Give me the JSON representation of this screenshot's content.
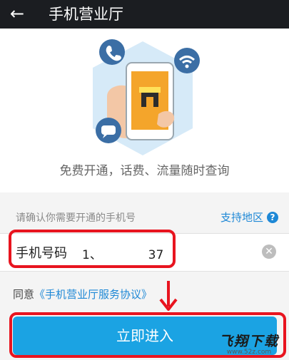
{
  "header": {
    "back_icon": "arrow-left-icon",
    "title": "手机营业厅"
  },
  "hero": {
    "tagline": "免费开通，话费、流量随时查询",
    "icons": [
      "phone-call-icon",
      "wifi-icon",
      "chat-icon",
      "store-icon"
    ]
  },
  "form": {
    "prompt": "请确认你需要开通的手机号",
    "support_link": "支持地区",
    "help_icon": "?",
    "phone_label": "手机号码",
    "phone_value": "1、            37",
    "clear_icon": "✕"
  },
  "agreement": {
    "prefix": "同意",
    "link": "《手机营业厅服务协议》"
  },
  "enter_button": {
    "label": "立即进入"
  },
  "watermark": {
    "text": "飞翔下载",
    "url": "www.52z.com"
  },
  "colors": {
    "accent": "#1ba3e3",
    "link": "#1e88d6",
    "annotation_red": "#e8141f",
    "topbar": "#1b1d21"
  }
}
